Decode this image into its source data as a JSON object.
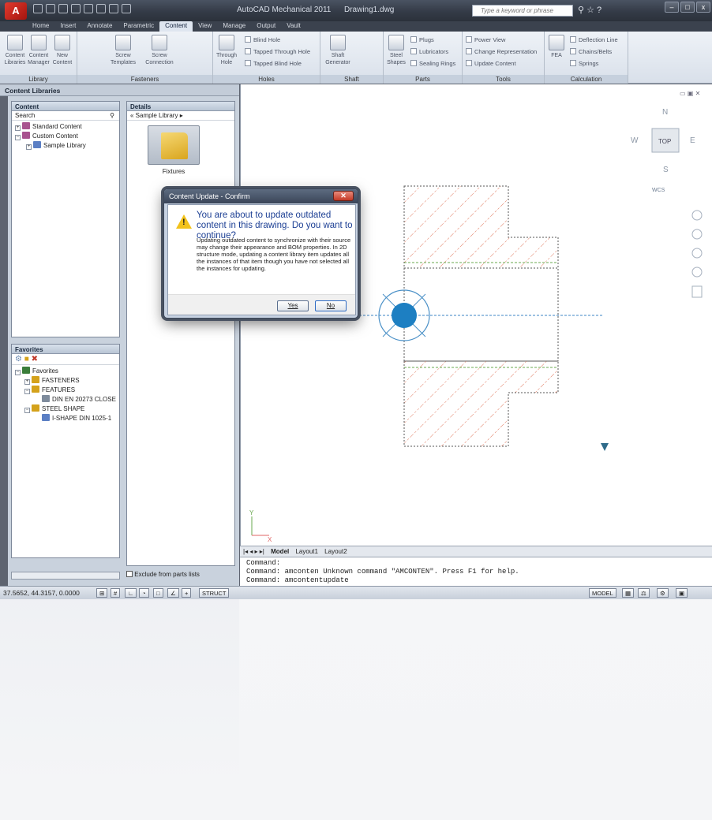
{
  "app": {
    "title": "AutoCAD Mechanical 2011",
    "document": "Drawing1.dwg",
    "search_placeholder": "Type a keyword or phrase"
  },
  "tabs": [
    "Home",
    "Insert",
    "Annotate",
    "Parametric",
    "Content",
    "View",
    "Manage",
    "Output",
    "Vault"
  ],
  "active_tab": "Content",
  "ribbon": {
    "library": {
      "title": "Library",
      "buttons": [
        "Content Libraries",
        "Content Manager",
        "New Content"
      ]
    },
    "fasteners": {
      "title": "Fasteners",
      "buttons": [
        "Screw Templates",
        "Screw Connection"
      ]
    },
    "holes": {
      "title": "Holes",
      "big": "Through Hole",
      "items": [
        "Blind Hole",
        "Tapped Through Hole",
        "Tapped Blind Hole"
      ]
    },
    "shaft": {
      "title": "Shaft",
      "big": "Shaft Generator"
    },
    "parts": {
      "title": "Parts",
      "big": "Steel Shapes",
      "items": [
        "Plugs",
        "Lubricators",
        "Sealing Rings"
      ]
    },
    "tools": {
      "title": "Tools",
      "items": [
        "Power View",
        "Change Representation",
        "Update Content"
      ]
    },
    "calculation": {
      "title": "Calculation",
      "big": "FEA",
      "items": [
        "Deflection Line",
        "Chains/Belts",
        "Springs"
      ]
    }
  },
  "palette": {
    "title": "Content Libraries",
    "content_header": "Content",
    "search_label": "Search",
    "tree": [
      "Standard Content",
      "Custom Content",
      "Sample Library"
    ],
    "details_header": "Details",
    "breadcrumb": "« Sample Library ▸",
    "folder_label": "Fixtures",
    "favorites_header": "Favorites",
    "favorites": [
      "Favorites",
      "FASTENERS",
      "FEATURES",
      "DIN EN 20273 CLOSE",
      "STEEL SHAPE",
      "I-SHAPE DIN 1025-1"
    ],
    "exclude_label": "Exclude from parts lists"
  },
  "viewcube": {
    "n": "N",
    "s": "S",
    "e": "E",
    "w": "W",
    "top": "TOP",
    "wcs": "WCS"
  },
  "layout_tabs": [
    "Model",
    "Layout1",
    "Layout2"
  ],
  "command_lines": [
    "Command:",
    "Command: amconten Unknown command \"AMCONTEN\".  Press F1 for help.",
    "Command: amcontentupdate"
  ],
  "status": {
    "coords": "37.5652, 44.3157, 0.0000",
    "struct": "STRUCT",
    "model": "MODEL"
  },
  "dialog": {
    "title": "Content Update - Confirm",
    "heading": "You are about to update outdated content in this drawing. Do you want to continue?",
    "body": "Updating outdated content to synchronize with their source may change their appearance and BOM properties. In 2D structure mode, updating a content library item updates all the instances of that item though you have not selected all the instances for updating.",
    "yes": "Yes",
    "no": "No"
  }
}
